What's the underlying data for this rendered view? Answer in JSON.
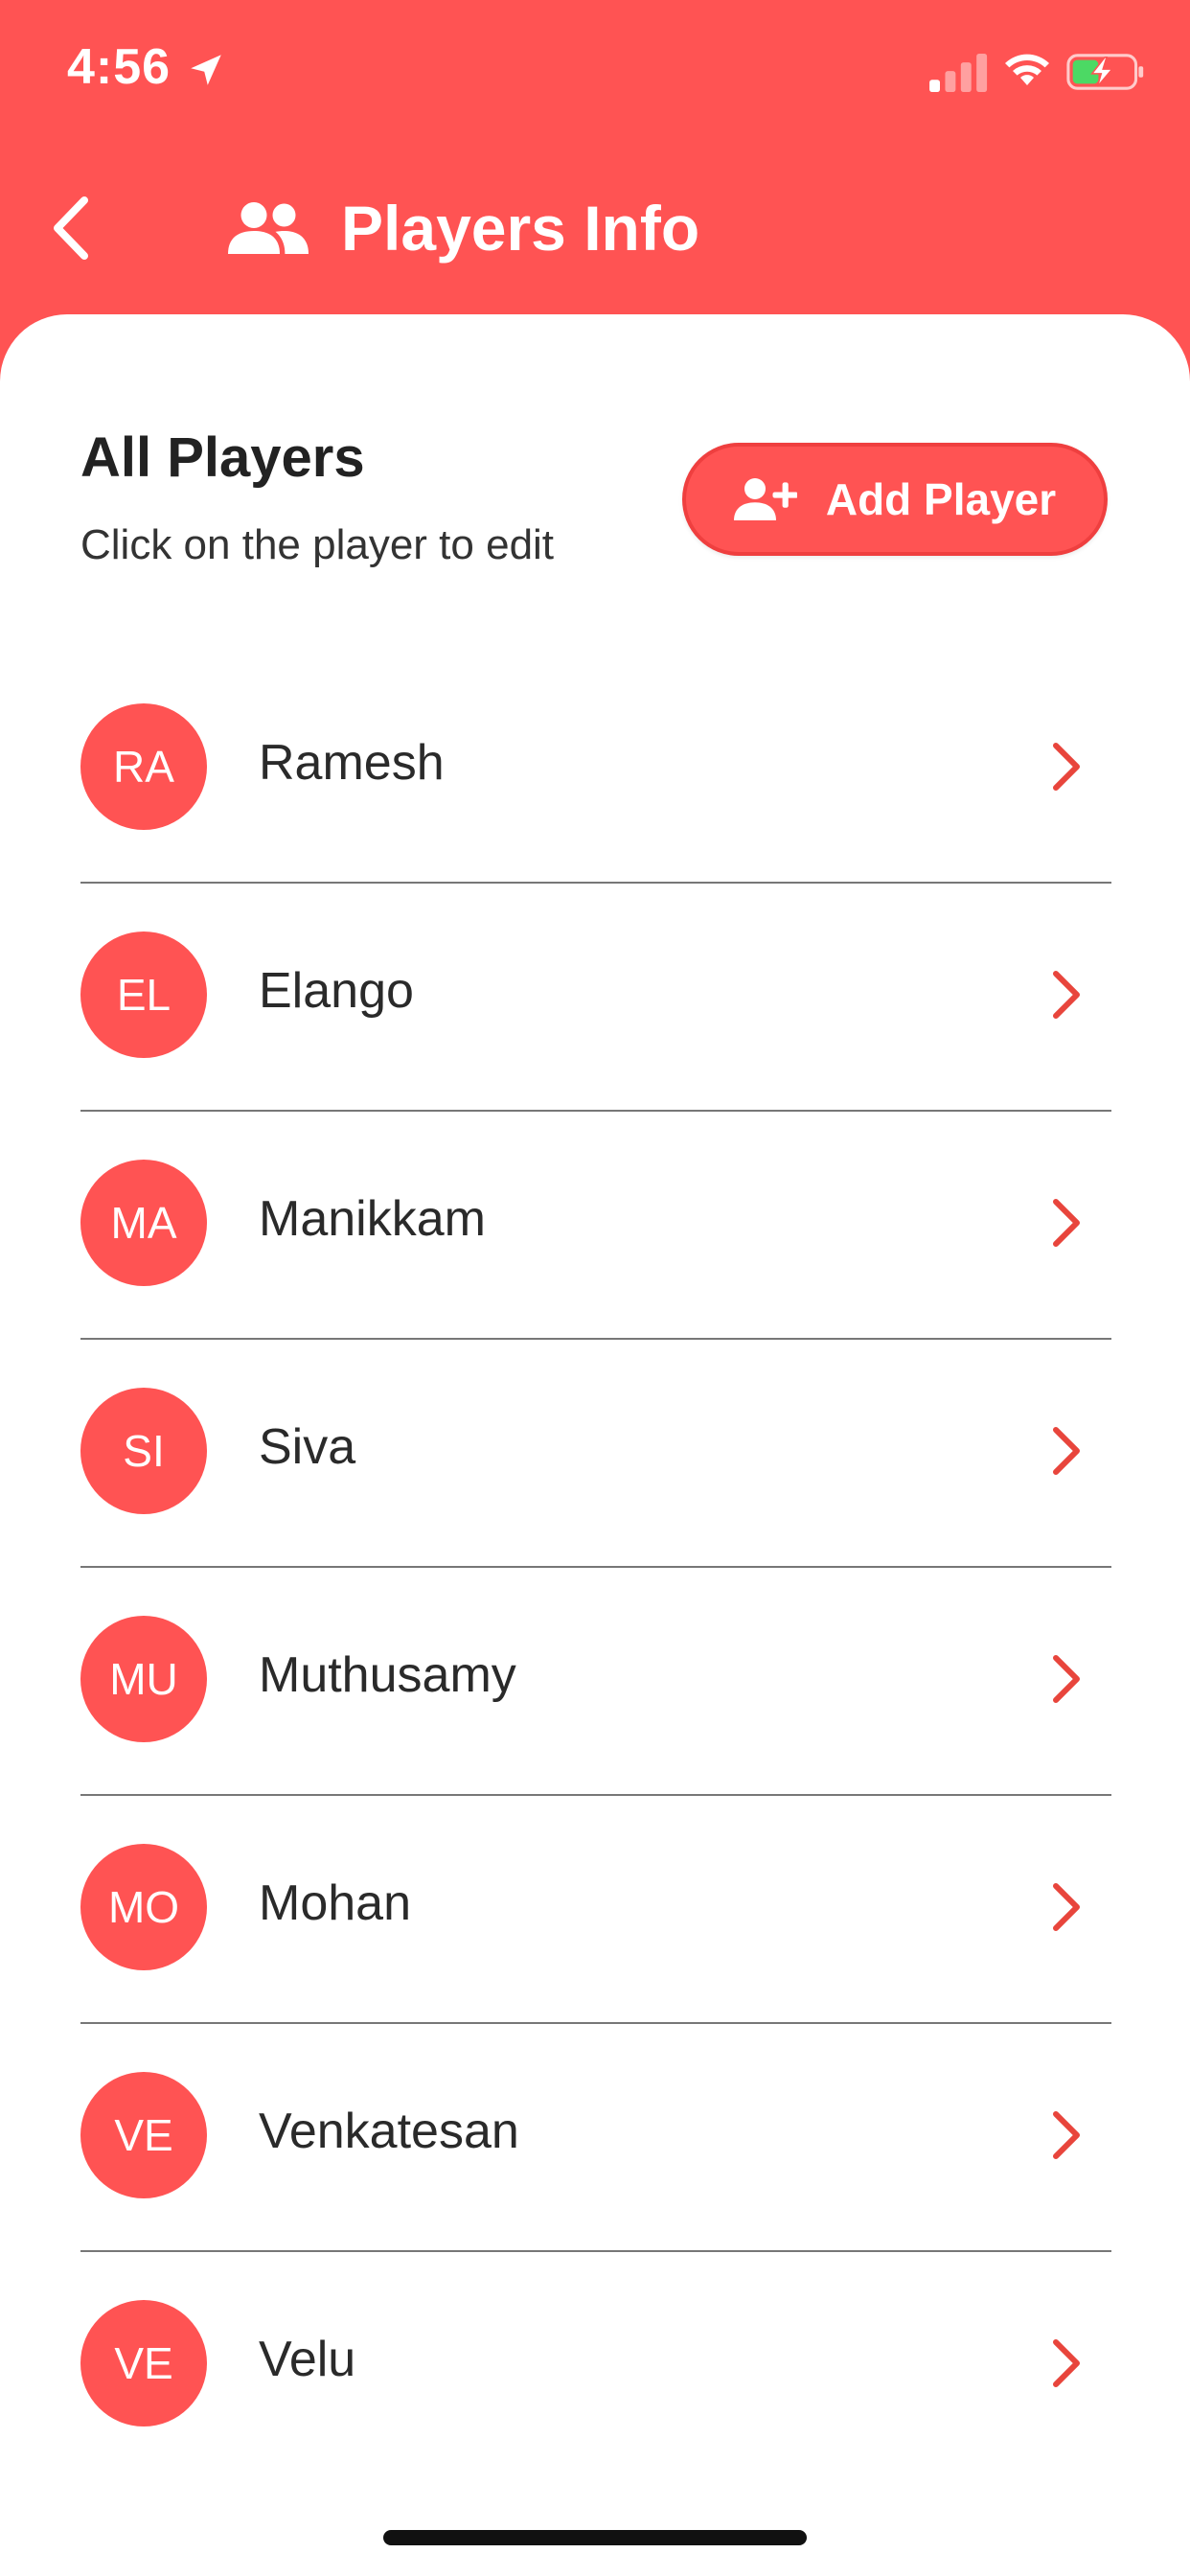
{
  "status_bar": {
    "time": "4:56",
    "icons": [
      "location-arrow-icon",
      "cellular-signal-icon",
      "wifi-icon",
      "battery-charging-icon"
    ]
  },
  "header": {
    "title": "Players Info",
    "back_icon": "chevron-left-icon",
    "title_icon": "people-icon"
  },
  "section": {
    "title": "All Players",
    "subtitle": "Click on the player to edit",
    "add_button_label": "Add Player",
    "add_button_icon": "add-user-icon"
  },
  "players": [
    {
      "initials": "RA",
      "name": "Ramesh"
    },
    {
      "initials": "EL",
      "name": "Elango"
    },
    {
      "initials": "MA",
      "name": "Manikkam"
    },
    {
      "initials": "SI",
      "name": "Siva"
    },
    {
      "initials": "MU",
      "name": "Muthusamy"
    },
    {
      "initials": "MO",
      "name": "Mohan"
    },
    {
      "initials": "VE",
      "name": "Venkatesan"
    },
    {
      "initials": "VE",
      "name": "Velu"
    }
  ],
  "colors": {
    "accent": "#ff5353",
    "chevron": "#e8453c",
    "text": "#2a2a2a",
    "background": "#ffffff"
  }
}
